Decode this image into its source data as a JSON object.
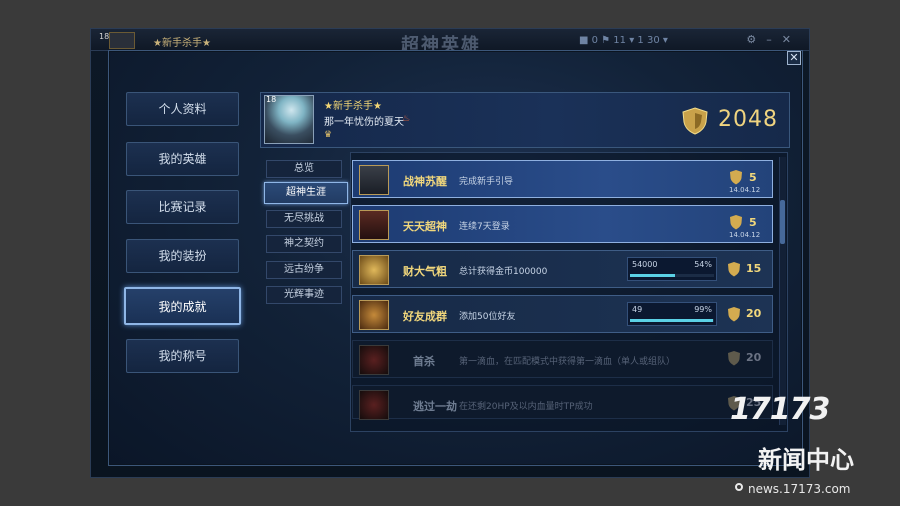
{
  "background_window": {
    "level": "18",
    "player_name": "★新手杀手★",
    "logo_text": "超神英雄",
    "stats": "■  0   ⚑ 11  ▾ 1  30  ▾"
  },
  "close_label": "✕",
  "nav": [
    {
      "label": "个人资料"
    },
    {
      "label": "我的英雄"
    },
    {
      "label": "比赛记录"
    },
    {
      "label": "我的装扮"
    },
    {
      "label": "我的成就"
    },
    {
      "label": "我的称号"
    }
  ],
  "profile": {
    "level": "18",
    "name": "★新手杀手★",
    "signature": "那一年忧伤的夏天",
    "score": "2048"
  },
  "subtabs": [
    {
      "label": "总览"
    },
    {
      "label": "超神生涯"
    },
    {
      "label": "无尽挑战"
    },
    {
      "label": "神之契约"
    },
    {
      "label": "远古纷争"
    },
    {
      "label": "光辉事迹"
    }
  ],
  "achievements": [
    {
      "title": "战神苏醒",
      "desc": "完成新手引导",
      "points": "5",
      "date": "14.04.12",
      "state": "highlight"
    },
    {
      "title": "天天超神",
      "desc": "连续7天登录",
      "points": "5",
      "date": "14.04.12",
      "state": "highlight"
    },
    {
      "title": "财大气粗",
      "desc": "总计获得金币100000",
      "points": "15",
      "progress_current": "54000",
      "progress_percent": "54%",
      "progress_fraction": 0.54,
      "state": "progress"
    },
    {
      "title": "好友成群",
      "desc": "添加50位好友",
      "points": "20",
      "progress_current": "49",
      "progress_percent": "99%",
      "progress_fraction": 0.99,
      "state": "progress"
    },
    {
      "title": "首杀",
      "desc": "第一滴血，在匹配模式中获得第一滴血（单人或组队）",
      "points": "20",
      "state": "locked"
    },
    {
      "title": "逃过一劫",
      "desc": "在还剩20HP及以内血量时TP成功",
      "points": "25",
      "state": "locked"
    }
  ],
  "watermark": {
    "number": "17173",
    "text": "新闻中心",
    "url": "news.17173.com"
  },
  "colors": {
    "gold": "#f1d77c",
    "accent_blue": "#8fb6e6",
    "progress": "#5bd1e6"
  }
}
